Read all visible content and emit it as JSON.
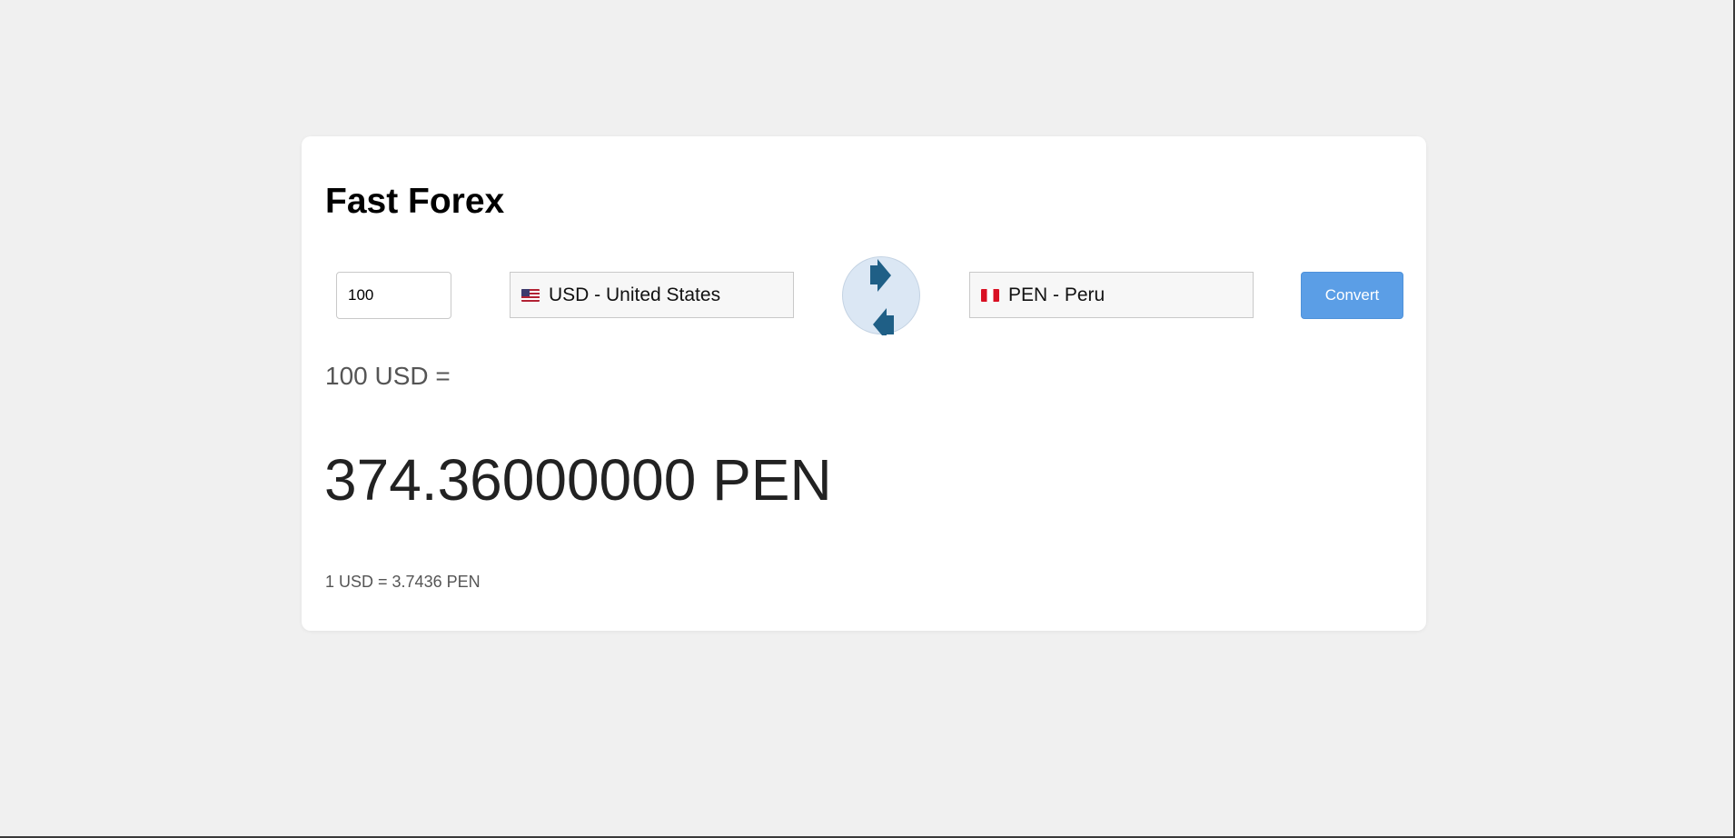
{
  "app": {
    "title": "Fast Forex"
  },
  "converter": {
    "amount_value": "100",
    "from_currency": {
      "flag": "us-flag-icon",
      "label": "USD - United States"
    },
    "to_currency": {
      "flag": "pe-flag-icon",
      "label": "PEN - Peru"
    },
    "swap_icon": "swap-arrows-icon",
    "convert_label": "Convert"
  },
  "result": {
    "from_text": "100 USD =",
    "converted_text": "374.36000000 PEN",
    "rate_text": "1 USD = 3.7436 PEN"
  },
  "colors": {
    "page_background": "#f0f0f0",
    "card_background": "#ffffff",
    "accent_button": "#5b9ee6",
    "swap_circle": "#dbe7f4",
    "swap_arrows": "#1f5f86"
  }
}
